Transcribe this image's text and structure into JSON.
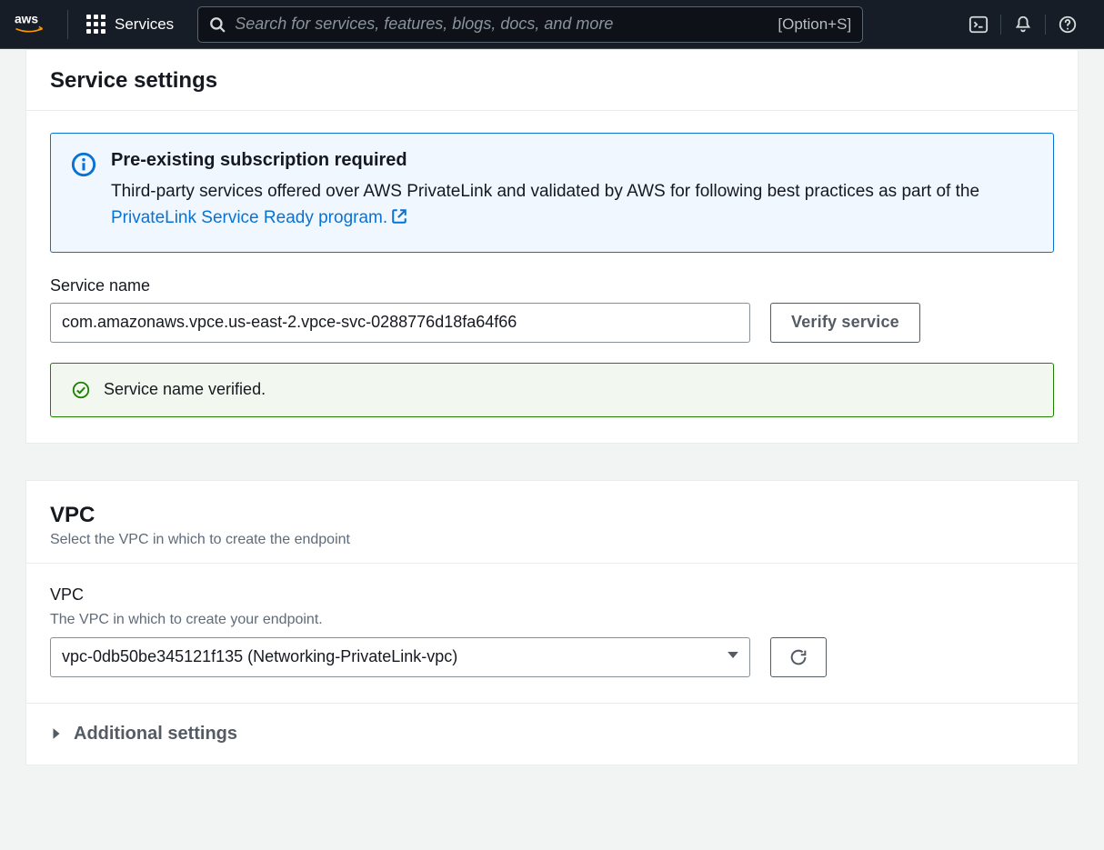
{
  "nav": {
    "services_label": "Services",
    "search_placeholder": "Search for services, features, blogs, docs, and more",
    "search_shortcut": "[Option+S]"
  },
  "service_settings": {
    "title": "Service settings",
    "info": {
      "title": "Pre-existing subscription required",
      "text_before_link": "Third-party services offered over AWS PrivateLink and validated by AWS for following best practices as part of the ",
      "link_text": "PrivateLink Service Ready program."
    },
    "service_name_label": "Service name",
    "service_name_value": "com.amazonaws.vpce.us-east-2.vpce-svc-0288776d18fa64f66",
    "verify_button": "Verify service",
    "verified_message": "Service name verified."
  },
  "vpc": {
    "title": "VPC",
    "subtitle": "Select the VPC in which to create the endpoint",
    "field_label": "VPC",
    "field_sublabel": "The VPC in which to create your endpoint.",
    "selected_value": "vpc-0db50be345121f135 (Networking-PrivateLink-vpc)",
    "additional_settings_label": "Additional settings"
  },
  "colors": {
    "link": "#0972d3",
    "success": "#1d8102"
  }
}
